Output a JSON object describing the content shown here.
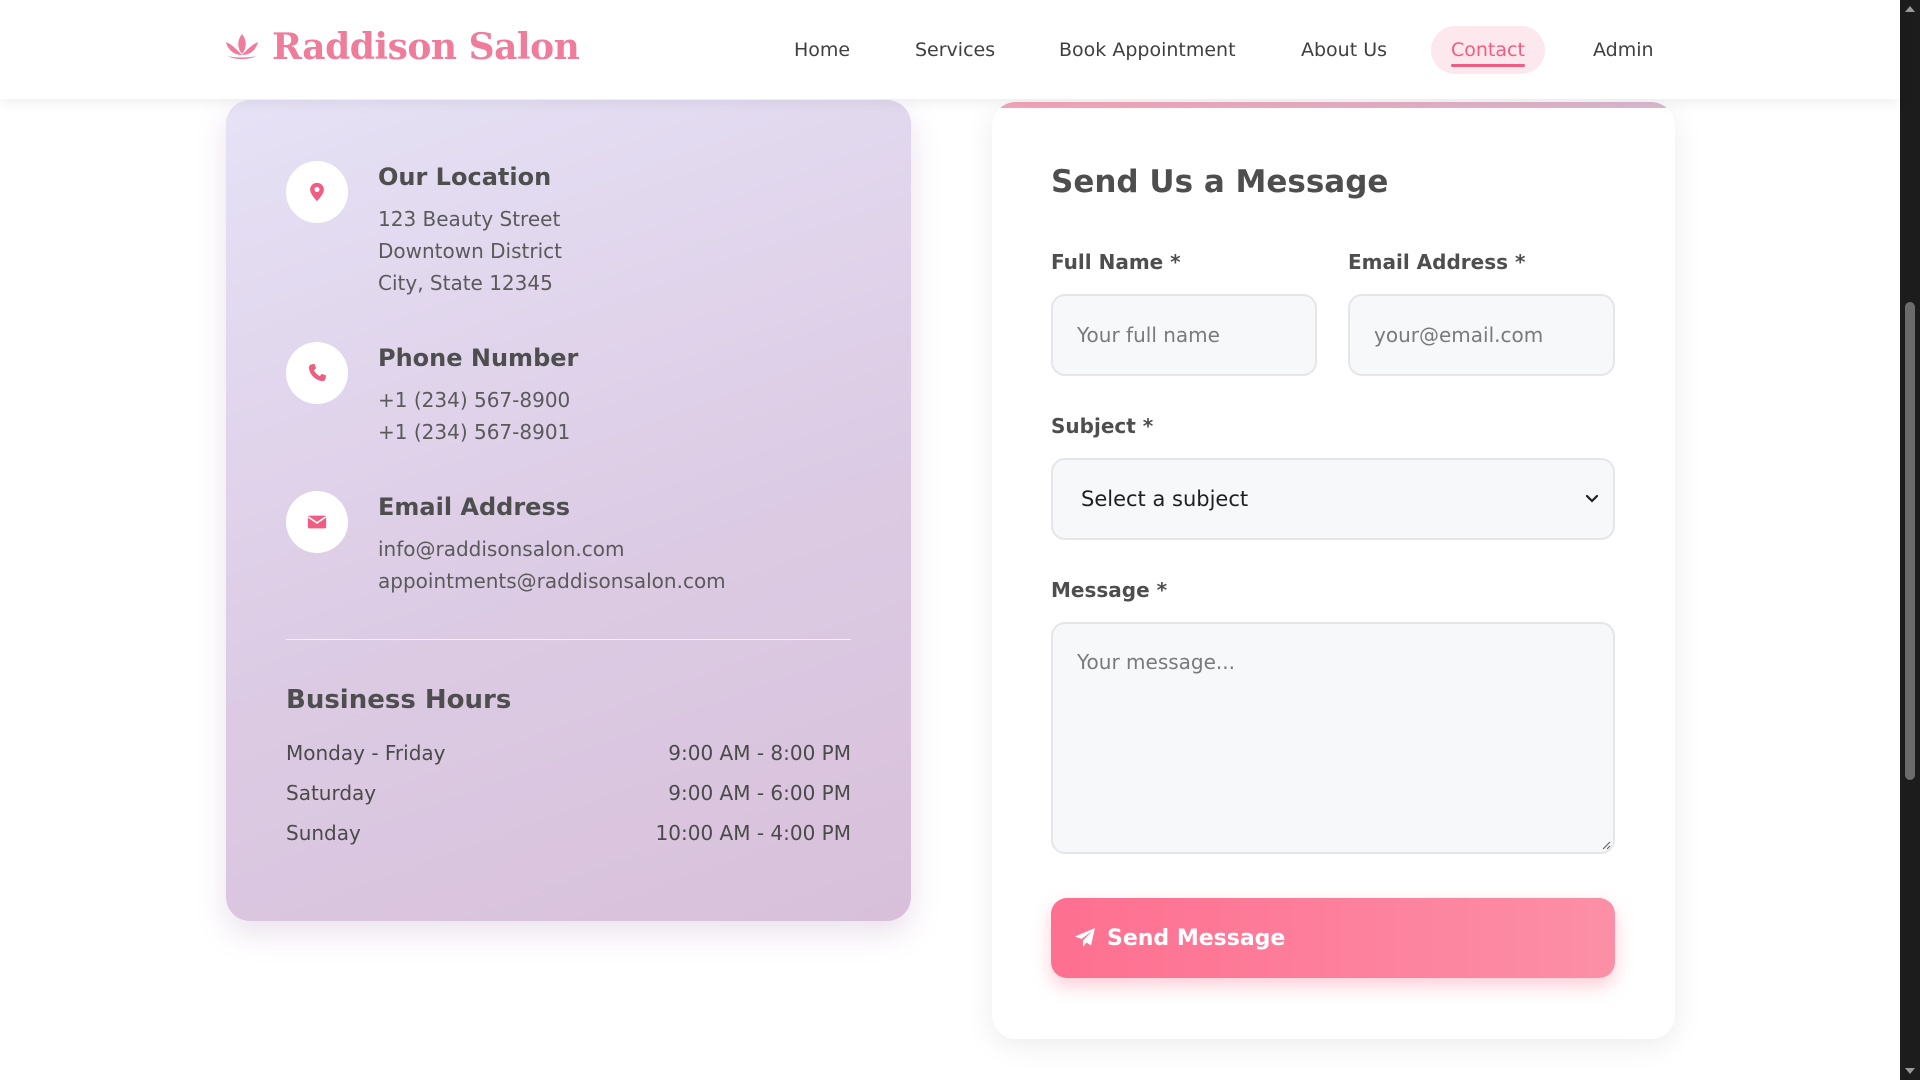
{
  "header": {
    "brand_name": "Raddison Salon",
    "brand_icon": "lotus-icon",
    "nav": [
      {
        "label": "Home"
      },
      {
        "label": "Services"
      },
      {
        "label": "Book Appointment"
      },
      {
        "label": "About Us"
      },
      {
        "label": "Contact",
        "active": true
      },
      {
        "label": "Admin"
      }
    ]
  },
  "contact_info": {
    "location": {
      "icon": "map-pin-icon",
      "title": "Our Location",
      "lines": [
        "123 Beauty Street",
        "Downtown District",
        "City, State 12345"
      ]
    },
    "phone": {
      "icon": "phone-icon",
      "title": "Phone Number",
      "lines": [
        "+1 (234) 567-8900",
        "+1 (234) 567-8901"
      ]
    },
    "email": {
      "icon": "envelope-icon",
      "title": "Email Address",
      "lines": [
        "info@raddisonsalon.com",
        "appointments@raddisonsalon.com"
      ]
    },
    "hours": {
      "title": "Business Hours",
      "rows": [
        {
          "day": "Monday - Friday",
          "time": "9:00 AM - 8:00 PM"
        },
        {
          "day": "Saturday",
          "time": "9:00 AM - 6:00 PM"
        },
        {
          "day": "Sunday",
          "time": "10:00 AM - 4:00 PM"
        }
      ]
    }
  },
  "form": {
    "title": "Send Us a Message",
    "full_name_label": "Full Name *",
    "full_name_placeholder": "Your full name",
    "email_label": "Email Address *",
    "email_placeholder": "your@email.com",
    "subject_label": "Subject *",
    "subject_value": "Select a subject",
    "message_label": "Message *",
    "message_placeholder": "Your message...",
    "submit_label": "Send Message"
  },
  "colors": {
    "brand_pink": "#f07c9c",
    "accent": "#f05c82",
    "button_start": "#fe6f90",
    "button_end": "#fc8fa6",
    "card_lavender": "#e0d4ec"
  }
}
